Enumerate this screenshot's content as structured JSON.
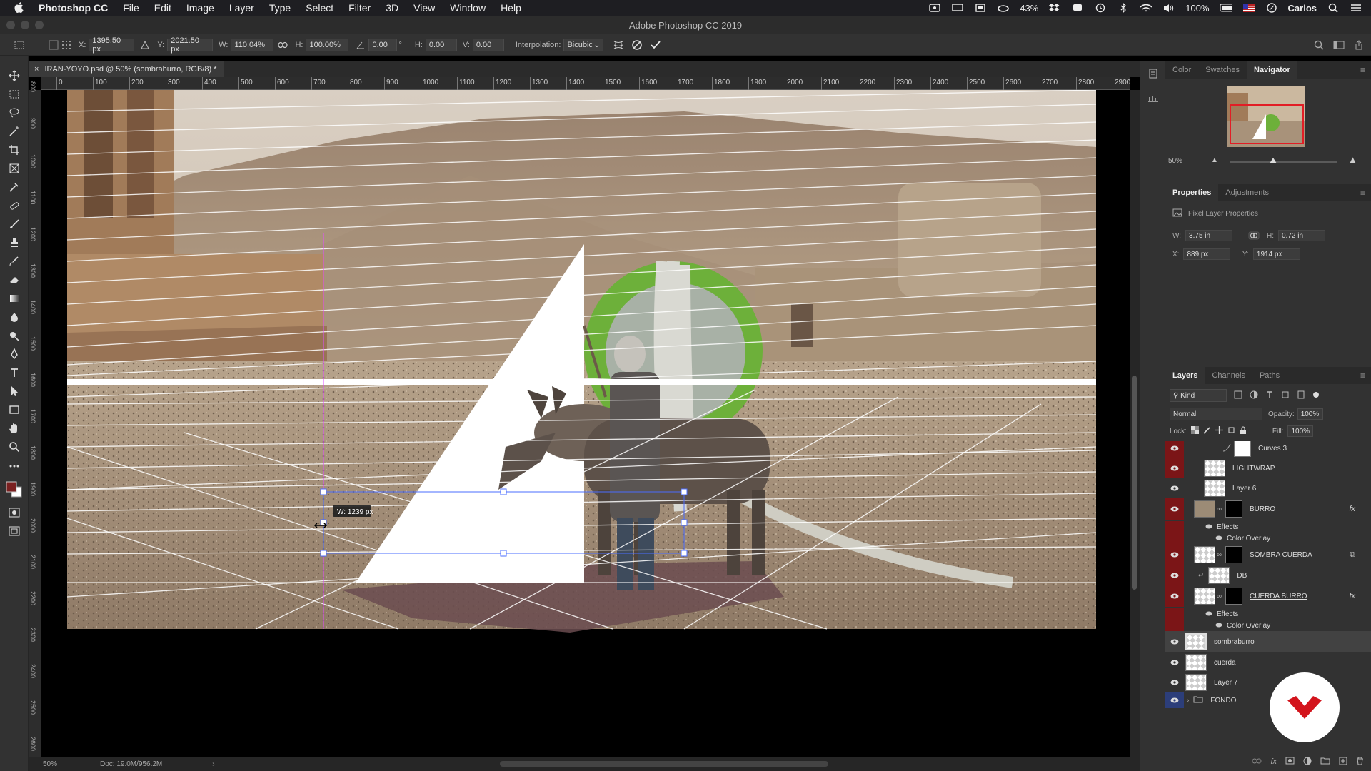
{
  "menubar": {
    "app_name": "Photoshop CC",
    "items": [
      "File",
      "Edit",
      "Image",
      "Layer",
      "Type",
      "Select",
      "Filter",
      "3D",
      "View",
      "Window",
      "Help"
    ],
    "battery_small": "43%",
    "battery": "100%",
    "user": "Carlos"
  },
  "window": {
    "title": "Adobe Photoshop CC 2019"
  },
  "options": {
    "x_label": "X:",
    "x_value": "1395.50 px",
    "y_label": "Y:",
    "y_value": "2021.50 px",
    "w_label": "W:",
    "w_value": "110.04%",
    "h_label": "H:",
    "h_value": "100.00%",
    "angle_value": "0.00",
    "angle_unit": "°",
    "hskew_label": "H:",
    "hskew_value": "0.00",
    "vskew_label": "V:",
    "vskew_value": "0.00",
    "interp_label": "Interpolation:",
    "interp_value": "Bicubic"
  },
  "document": {
    "tab_title": "IRAN-YOYO.psd @ 50% (sombraburro, RGB/8) *",
    "zoom": "50%",
    "doc_size": "Doc: 19.0M/956.2M",
    "ruler_h": [
      "0",
      "100",
      "200",
      "300",
      "400",
      "500",
      "600",
      "700",
      "800",
      "900",
      "1000",
      "1100",
      "1200",
      "1300",
      "1400",
      "1500",
      "1600",
      "1700",
      "1800",
      "1900",
      "2000",
      "2100",
      "2200",
      "2300",
      "2400",
      "2500",
      "2600",
      "2700",
      "2800",
      "2900"
    ],
    "ruler_v": [
      "800",
      "900",
      "1000",
      "1100",
      "1200",
      "1300",
      "1400",
      "1500",
      "1600",
      "1700",
      "1800",
      "1900",
      "2000",
      "2100",
      "2200",
      "2300",
      "2400",
      "2500",
      "2600"
    ],
    "transform_tooltip": "W: 1239 px"
  },
  "panels": {
    "top_tabs": [
      "Color",
      "Swatches",
      "Navigator"
    ],
    "nav_zoom": "50%",
    "prop_tabs": [
      "Properties",
      "Adjustments"
    ],
    "prop_title": "Pixel Layer Properties",
    "prop_w_label": "W:",
    "prop_w": "3.75 in",
    "prop_h_label": "H:",
    "prop_h": "0.72 in",
    "prop_x_label": "X:",
    "prop_x": "889 px",
    "prop_y_label": "Y:",
    "prop_y": "1914 px",
    "layer_tabs": [
      "Layers",
      "Channels",
      "Paths"
    ],
    "kind": "Kind",
    "blend_mode": "Normal",
    "opacity_label": "Opacity:",
    "opacity": "100%",
    "lock_label": "Lock:",
    "fill_label": "Fill:",
    "fill": "100%"
  },
  "layers": [
    {
      "name": "Curves 3"
    },
    {
      "name": "LIGHTWRAP"
    },
    {
      "name": "Layer 6"
    },
    {
      "name": "BURRO"
    },
    {
      "name": "Effects"
    },
    {
      "name": "Color Overlay"
    },
    {
      "name": "SOMBRA CUERDA"
    },
    {
      "name": "DB"
    },
    {
      "name": "CUERDA BURRO"
    },
    {
      "name": "Effects"
    },
    {
      "name": "Color Overlay"
    },
    {
      "name": "sombraburro"
    },
    {
      "name": "cuerda"
    },
    {
      "name": "Layer 7"
    },
    {
      "name": "FONDO"
    }
  ],
  "colors": {
    "accent_red": "#e21d25",
    "layer_red": "#7b1517",
    "ui_bg": "#323232"
  }
}
